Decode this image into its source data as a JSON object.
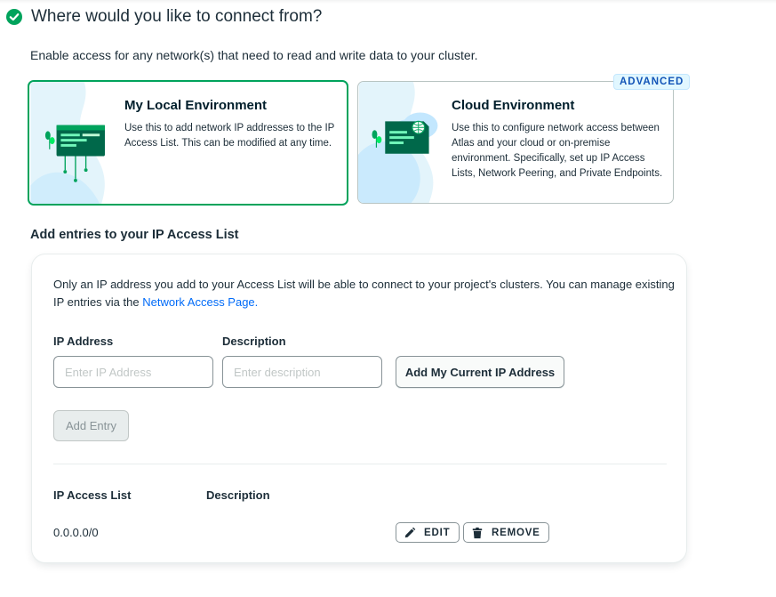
{
  "section": {
    "title": "Where would you like to connect from?",
    "intro": "Enable access for any network(s) that need to read and write data to your cluster."
  },
  "cards": {
    "local": {
      "title": "My Local Environment",
      "description": "Use this to add network IP addresses to the IP Access List. This can be modified at any time."
    },
    "cloud": {
      "title": "Cloud Environment",
      "description": "Use this to configure network access between Atlas and your cloud or on-premise environment. Specifically, set up IP Access Lists, Network Peering, and Private Endpoints.",
      "badge": "ADVANCED"
    }
  },
  "access_list": {
    "heading": "Add entries to your IP Access List",
    "note": "Only an IP address you add to your Access List will be able to connect to your project's clusters. You can manage existing IP entries via the ",
    "note_link": "Network Access Page.",
    "ip_label": "IP Address",
    "ip_placeholder": "Enter IP Address",
    "desc_label": "Description",
    "desc_placeholder": "Enter description",
    "current_ip_button": "Add My Current IP Address",
    "add_entry_button": "Add Entry",
    "table": {
      "col_ip": "IP Access List",
      "col_desc": "Description",
      "rows": [
        {
          "ip": "0.0.0.0/0",
          "description": "",
          "edit": "EDIT",
          "remove": "REMOVE"
        }
      ]
    }
  },
  "colors": {
    "accent_green": "#00a35c",
    "link_blue": "#016bf8",
    "badge_bg": "#e1f7ff",
    "badge_text": "#1254b7"
  }
}
